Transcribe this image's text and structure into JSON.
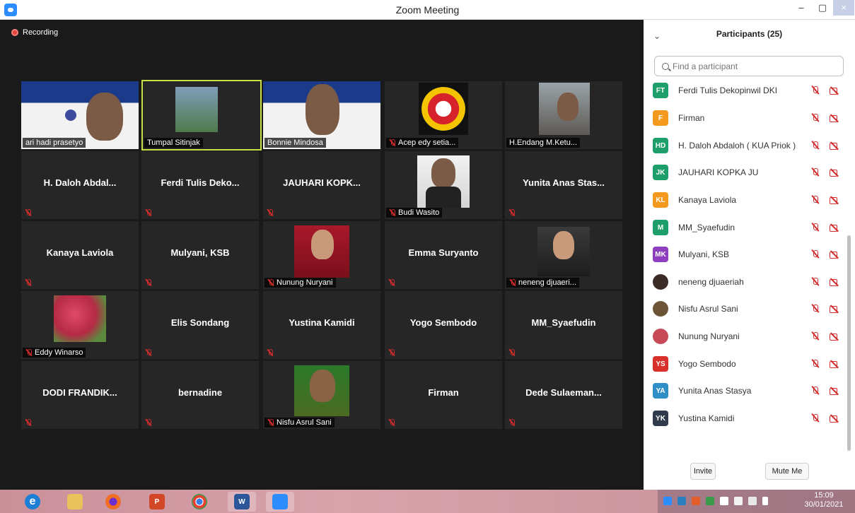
{
  "window": {
    "title": "Zoom Meeting",
    "minimize": "–",
    "maximize": "▢",
    "close": "×"
  },
  "recording": {
    "label": "Recording"
  },
  "tiles": [
    {
      "label": "ari hadi prasetyo"
    },
    {
      "label": "Tumpal Sitinjak"
    },
    {
      "label": "Bonnie Mindosa"
    },
    {
      "label": "Acep edy setia..."
    },
    {
      "label": "H.Endang M.Ketu..."
    },
    {
      "name": "H. Daloh Abdal..."
    },
    {
      "name": "Ferdi Tulis Deko..."
    },
    {
      "name": "JAUHARI KOPK..."
    },
    {
      "label": "Budi Wasito"
    },
    {
      "name": "Yunita Anas Stas..."
    },
    {
      "name": "Kanaya Laviola"
    },
    {
      "name": "Mulyani, KSB"
    },
    {
      "label": "Nunung Nuryani"
    },
    {
      "name": "Emma Suryanto"
    },
    {
      "label": "neneng djuaeri..."
    },
    {
      "label": "Eddy Winarso"
    },
    {
      "name": "Elis Sondang"
    },
    {
      "name": "Yustina Kamidi"
    },
    {
      "name": "Yogo Sembodo"
    },
    {
      "name": "MM_Syaefudin"
    },
    {
      "name": "DODI FRANDIK..."
    },
    {
      "name": "bernadine"
    },
    {
      "label": "Nisfu Asrul Sani"
    },
    {
      "name": "Firman"
    },
    {
      "name": "Dede Sulaeman..."
    }
  ],
  "panel": {
    "title": "Participants (25)",
    "search_placeholder": "Find a participant",
    "participants": [
      {
        "initials": "FT",
        "name": "Ferdi Tulis Dekopinwil DKI",
        "color": "#1e9e6a"
      },
      {
        "initials": "F",
        "name": "Firman",
        "color": "#f39a1e"
      },
      {
        "initials": "HD",
        "name": "H. Daloh Abdaloh ( KUA Priok )",
        "color": "#1e9e6a"
      },
      {
        "initials": "JK",
        "name": "JAUHARI KOPKA JU",
        "color": "#1e9e6a"
      },
      {
        "initials": "KL",
        "name": "Kanaya Laviola",
        "color": "#f39a1e"
      },
      {
        "initials": "M",
        "name": "MM_Syaefudin",
        "color": "#1e9e6a"
      },
      {
        "initials": "MK",
        "name": "Mulyani, KSB",
        "color": "#8e3fbf"
      },
      {
        "initials": "",
        "name": "neneng djuaeriah",
        "color": ""
      },
      {
        "initials": "",
        "name": "Nisfu Asrul Sani",
        "color": ""
      },
      {
        "initials": "",
        "name": "Nunung Nuryani",
        "color": ""
      },
      {
        "initials": "YS",
        "name": "Yogo Sembodo",
        "color": "#d8302a"
      },
      {
        "initials": "YA",
        "name": "Yunita Anas Stasya",
        "color": "#2e8fc7"
      },
      {
        "initials": "YK",
        "name": "Yustina Kamidi",
        "color": "#2f3a4a"
      }
    ],
    "invite_label": "Invite",
    "mute_me_label": "Mute Me"
  },
  "taskbar": {
    "apps": [
      {
        "icon": "internet-explorer-icon",
        "glyph": "e",
        "color": "#1c7fd6"
      },
      {
        "icon": "file-explorer-icon",
        "glyph": "",
        "color": "#e8c25a"
      },
      {
        "icon": "firefox-icon",
        "glyph": "",
        "color": "#f06d24"
      },
      {
        "icon": "powerpoint-icon",
        "glyph": "P",
        "color": "#d24726"
      },
      {
        "icon": "chrome-icon",
        "glyph": "",
        "color": "#3a9b4a"
      },
      {
        "icon": "word-icon",
        "glyph": "W",
        "color": "#2b579a"
      },
      {
        "icon": "zoom-icon",
        "glyph": "",
        "color": "#2d8cff"
      }
    ],
    "clock": {
      "time": "15:09",
      "date": "30/01/2021"
    }
  }
}
